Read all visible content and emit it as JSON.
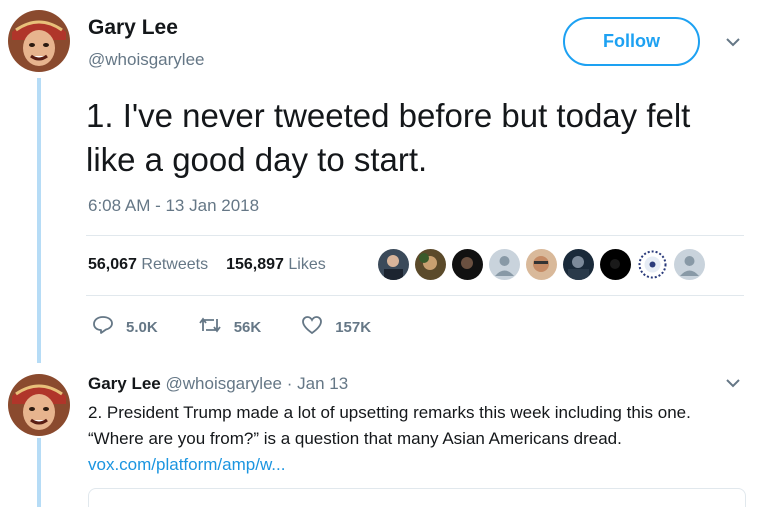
{
  "tweet": {
    "author_name": "Gary Lee",
    "author_handle": "@whoisgarylee",
    "follow_label": "Follow",
    "text": "1. I've never tweeted before but today felt like a good day to start.",
    "timestamp": "6:08 AM - 13 Jan 2018",
    "retweets_count": "56,067",
    "retweets_label": "Retweets",
    "likes_count": "156,897",
    "likes_label": "Likes",
    "replies_action_count": "5.0K",
    "retweets_action_count": "56K",
    "likes_action_count": "157K"
  },
  "reply": {
    "author_name": "Gary Lee",
    "author_handle": "@whoisgarylee",
    "date": "Jan 13",
    "text": "2. President Trump made a lot of upsetting remarks this week including this one. “Where are you from?” is a question that many Asian Americans dread.",
    "link_text": "vox.com/platform/amp/w..."
  },
  "icons": {
    "chevron": "chevron-down-icon",
    "reply": "reply-icon",
    "retweet": "retweet-icon",
    "like": "heart-icon"
  },
  "colors": {
    "accent": "#1da1f2",
    "thread_line": "#b6dcf6",
    "muted": "#657786"
  }
}
